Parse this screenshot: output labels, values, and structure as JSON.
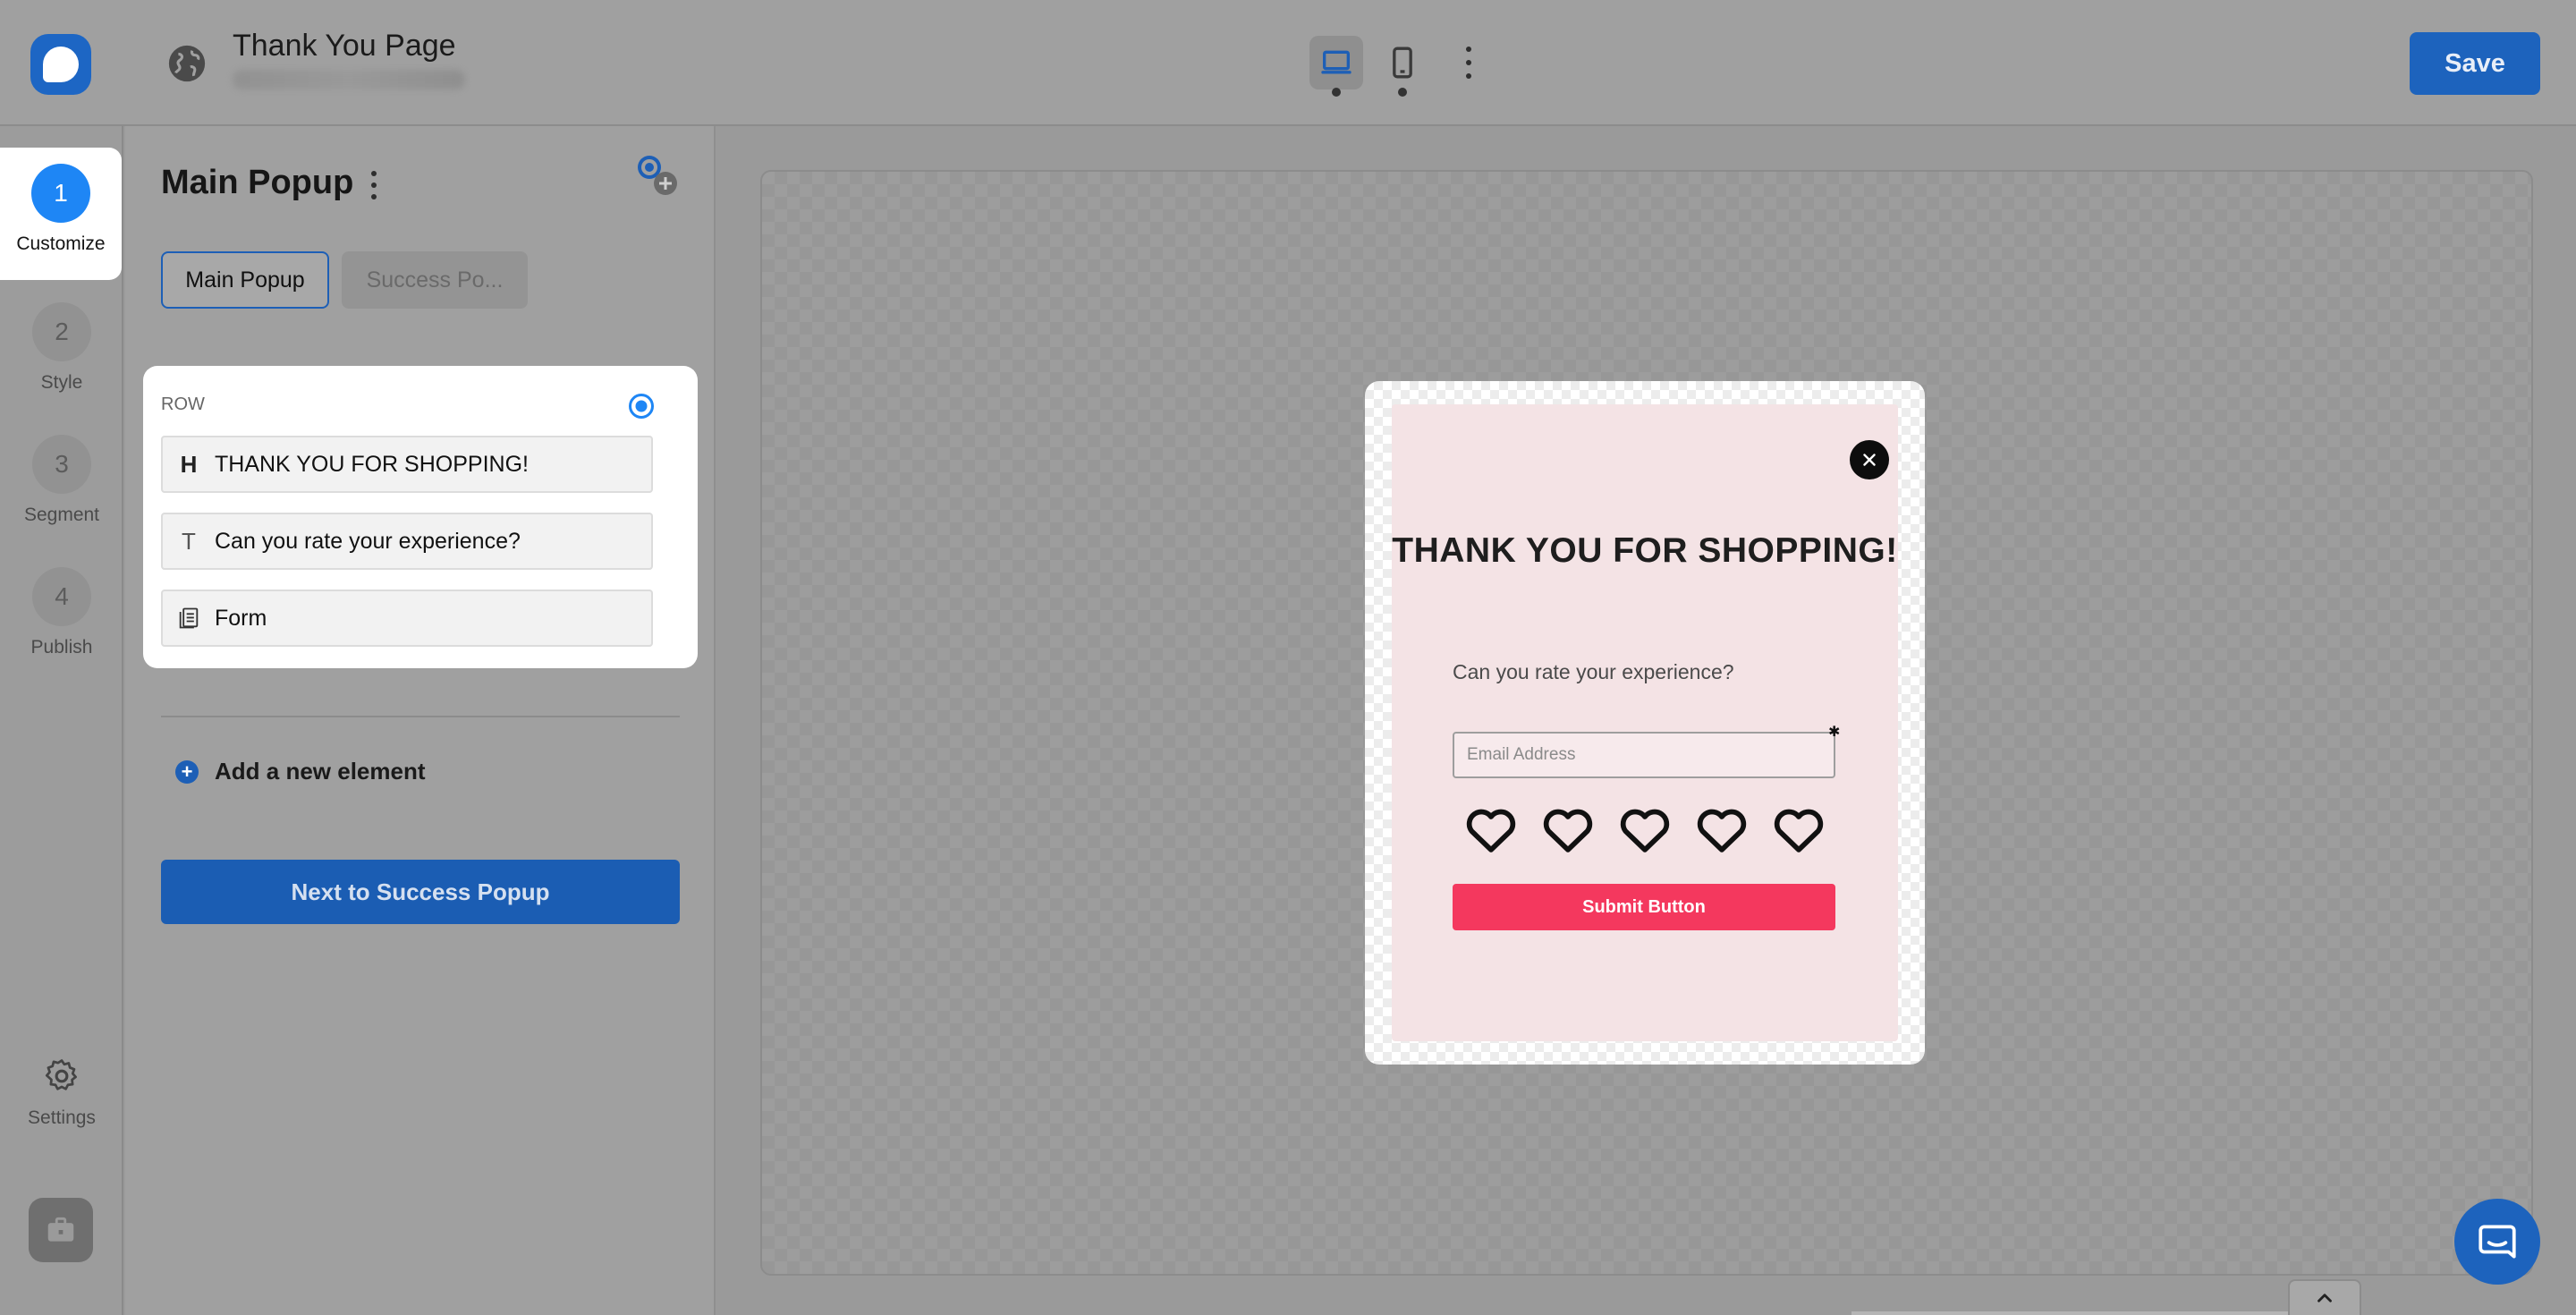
{
  "header": {
    "page_title": "Thank You Page",
    "save_label": "Save",
    "device_modes": [
      "laptop-icon",
      "phone-icon"
    ],
    "active_device": "laptop-icon"
  },
  "steps": [
    {
      "num": "1",
      "label": "Customize",
      "active": true
    },
    {
      "num": "2",
      "label": "Style"
    },
    {
      "num": "3",
      "label": "Segment"
    },
    {
      "num": "4",
      "label": "Publish"
    }
  ],
  "rail": {
    "settings_label": "Settings"
  },
  "panel": {
    "title": "Main Popup",
    "tabs": [
      {
        "label": "Main Popup",
        "active": true
      },
      {
        "label": "Success Po..."
      }
    ],
    "row": {
      "label": "ROW",
      "items": [
        {
          "icon": "heading-icon",
          "glyph": "H",
          "label": "THANK YOU FOR SHOPPING!"
        },
        {
          "icon": "text-icon",
          "glyph": "T",
          "label": "Can you rate your experience?"
        },
        {
          "icon": "form-icon",
          "glyph": "",
          "label": "Form"
        }
      ]
    },
    "add_element_label": "Add a new element",
    "next_button_label": "Next to Success Popup"
  },
  "popup": {
    "heading": "THANK YOU FOR SHOPPING!",
    "subtext": "Can you rate your experience?",
    "email_placeholder": "Email Address",
    "rating_count": 5,
    "submit_label": "Submit Button",
    "colors": {
      "background": "#f4e3e5",
      "submit": "#f4385e",
      "accent": "#1d63bd"
    }
  }
}
